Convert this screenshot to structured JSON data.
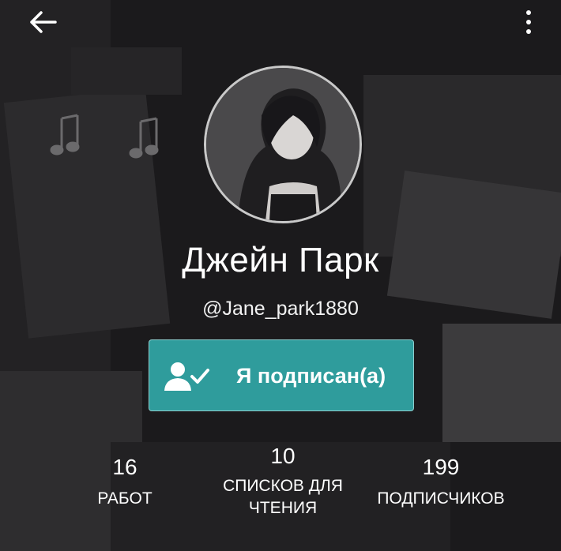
{
  "profile": {
    "name": "Джейн Парк",
    "username": "@Jane_park1880"
  },
  "follow_button": {
    "label": "Я подписан(а)",
    "icon": "user-check-icon"
  },
  "stats": {
    "works": {
      "value": "16",
      "label": "РАБОТ"
    },
    "reading_lists": {
      "value": "10",
      "label_line1": "СПИСКОВ ДЛЯ",
      "label_line2": "ЧТЕНИЯ"
    },
    "followers": {
      "value": "199",
      "label": "ПОДПИСЧИКОВ"
    }
  },
  "toolbar": {
    "back_icon": "arrow-left-icon",
    "more_icon": "more-vertical-icon"
  },
  "colors": {
    "accent": "#2f9c9c",
    "background": "#1b1a1c"
  }
}
